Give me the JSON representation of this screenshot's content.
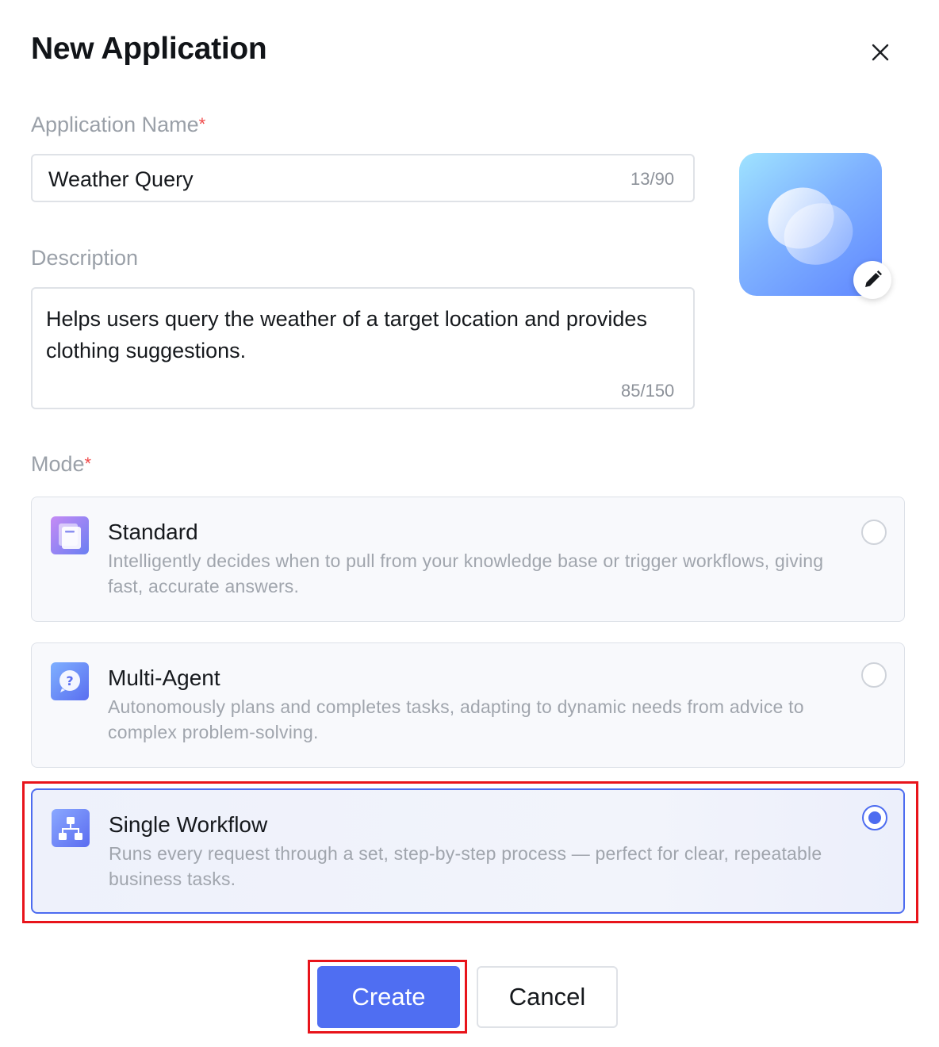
{
  "dialog": {
    "title": "New Application"
  },
  "form": {
    "name": {
      "label": "Application Name",
      "required_mark": "*",
      "value": "Weather Query",
      "counter": "13/90"
    },
    "description": {
      "label": "Description",
      "value": "Helps users query the weather of a target location and provides clothing suggestions.",
      "counter": "85/150"
    },
    "mode": {
      "label": "Mode",
      "required_mark": "*",
      "options": [
        {
          "title": "Standard",
          "description": "Intelligently decides when to pull from your knowledge base or trigger workflows, giving fast, accurate answers.",
          "icon": "document-icon",
          "selected": false
        },
        {
          "title": "Multi-Agent",
          "description": "Autonomously plans and completes tasks, adapting to dynamic needs from advice to complex problem-solving.",
          "icon": "question-bubble-icon",
          "selected": false
        },
        {
          "title": "Single Workflow",
          "description": "Runs every request through a set, step-by-step process — perfect for clear, repeatable business tasks.",
          "icon": "workflow-icon",
          "selected": true
        }
      ]
    }
  },
  "actions": {
    "create_label": "Create",
    "cancel_label": "Cancel"
  },
  "colors": {
    "primary": "#4f6ef2",
    "required": "#f04a4a",
    "highlight": "#e8141b"
  }
}
